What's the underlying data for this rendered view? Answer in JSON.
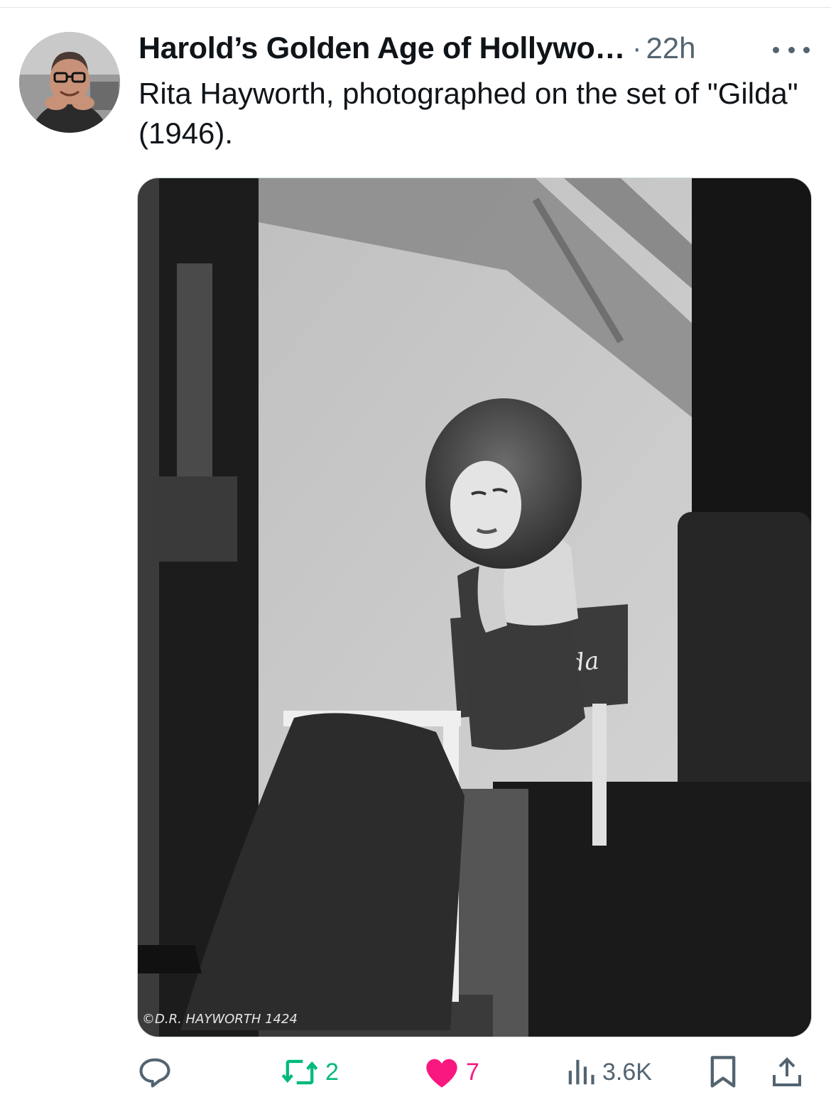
{
  "post": {
    "author": {
      "display_name": "Harold’s Golden Age of Hollywo…",
      "avatar_icon": "avatar-photo"
    },
    "separator": "·",
    "timestamp": "22h",
    "more_icon": "ellipsis-icon",
    "text": "Rita Hayworth, photographed on the set of \"Gilda\" (1946).",
    "media": {
      "kind": "photo",
      "description_icon": "black-and-white-photo",
      "chair_text": "Gilda",
      "caption_text": "©D.R. HAYWORTH 1424"
    }
  },
  "actions": {
    "reply": {
      "icon": "reply-icon",
      "count": ""
    },
    "repost": {
      "icon": "repost-icon",
      "count": "2",
      "color": "#00ba7c"
    },
    "like": {
      "icon": "heart-filled-icon",
      "count": "7",
      "color": "#f91880"
    },
    "views": {
      "icon": "views-icon",
      "count": "3.6K"
    },
    "bookmark": {
      "icon": "bookmark-icon"
    },
    "share": {
      "icon": "share-icon"
    }
  },
  "colors": {
    "primary_text": "#0f1419",
    "secondary_text": "#536471",
    "repost_green": "#00ba7c",
    "like_pink": "#f91880"
  }
}
